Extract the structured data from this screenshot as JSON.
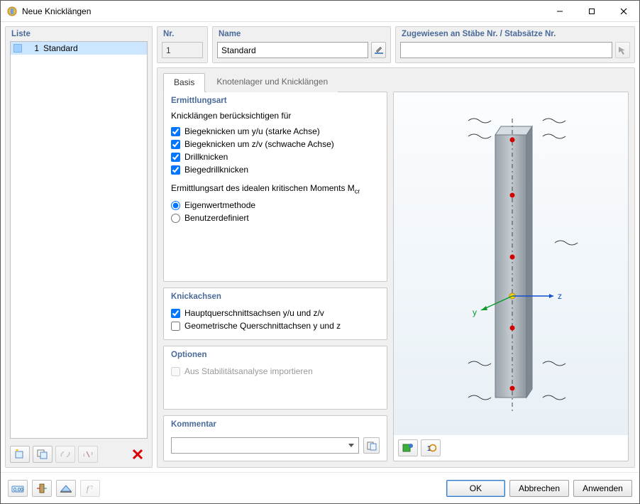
{
  "window": {
    "title": "Neue Knicklängen"
  },
  "sidebar": {
    "header": "Liste",
    "items": [
      {
        "num": "1",
        "name": "Standard"
      }
    ]
  },
  "fields": {
    "nr_label": "Nr.",
    "nr_value": "1",
    "name_label": "Name",
    "name_value": "Standard",
    "assign_label": "Zugewiesen an Stäbe Nr. / Stabsätze Nr.",
    "assign_value": ""
  },
  "tabs": {
    "basis": "Basis",
    "knoten": "Knotenlager und Knicklängen"
  },
  "group_ermittlung": {
    "title": "Ermittlungsart",
    "sub1": "Knicklängen berücksichtigen für",
    "c1": "Biegeknicken um y/u (starke Achse)",
    "c2": "Biegeknicken um z/v (schwache Achse)",
    "c3": "Drillknicken",
    "c4": "Biegedrillknicken",
    "sub2_pre": "Ermittlungsart des idealen kritischen Moments M",
    "sub2_sub": "cr",
    "r1": "Eigenwertmethode",
    "r2": "Benutzerdefiniert"
  },
  "group_achsen": {
    "title": "Knickachsen",
    "c1": "Hauptquerschnittsachsen y/u und z/v",
    "c2": "Geometrische Querschnittachsen y und z"
  },
  "group_optionen": {
    "title": "Optionen",
    "c1": "Aus Stabilitätsanalyse importieren"
  },
  "group_kommentar": {
    "title": "Kommentar",
    "value": ""
  },
  "axes": {
    "y": "y",
    "z": "z"
  },
  "buttons": {
    "ok": "OK",
    "cancel": "Abbrechen",
    "apply": "Anwenden"
  }
}
